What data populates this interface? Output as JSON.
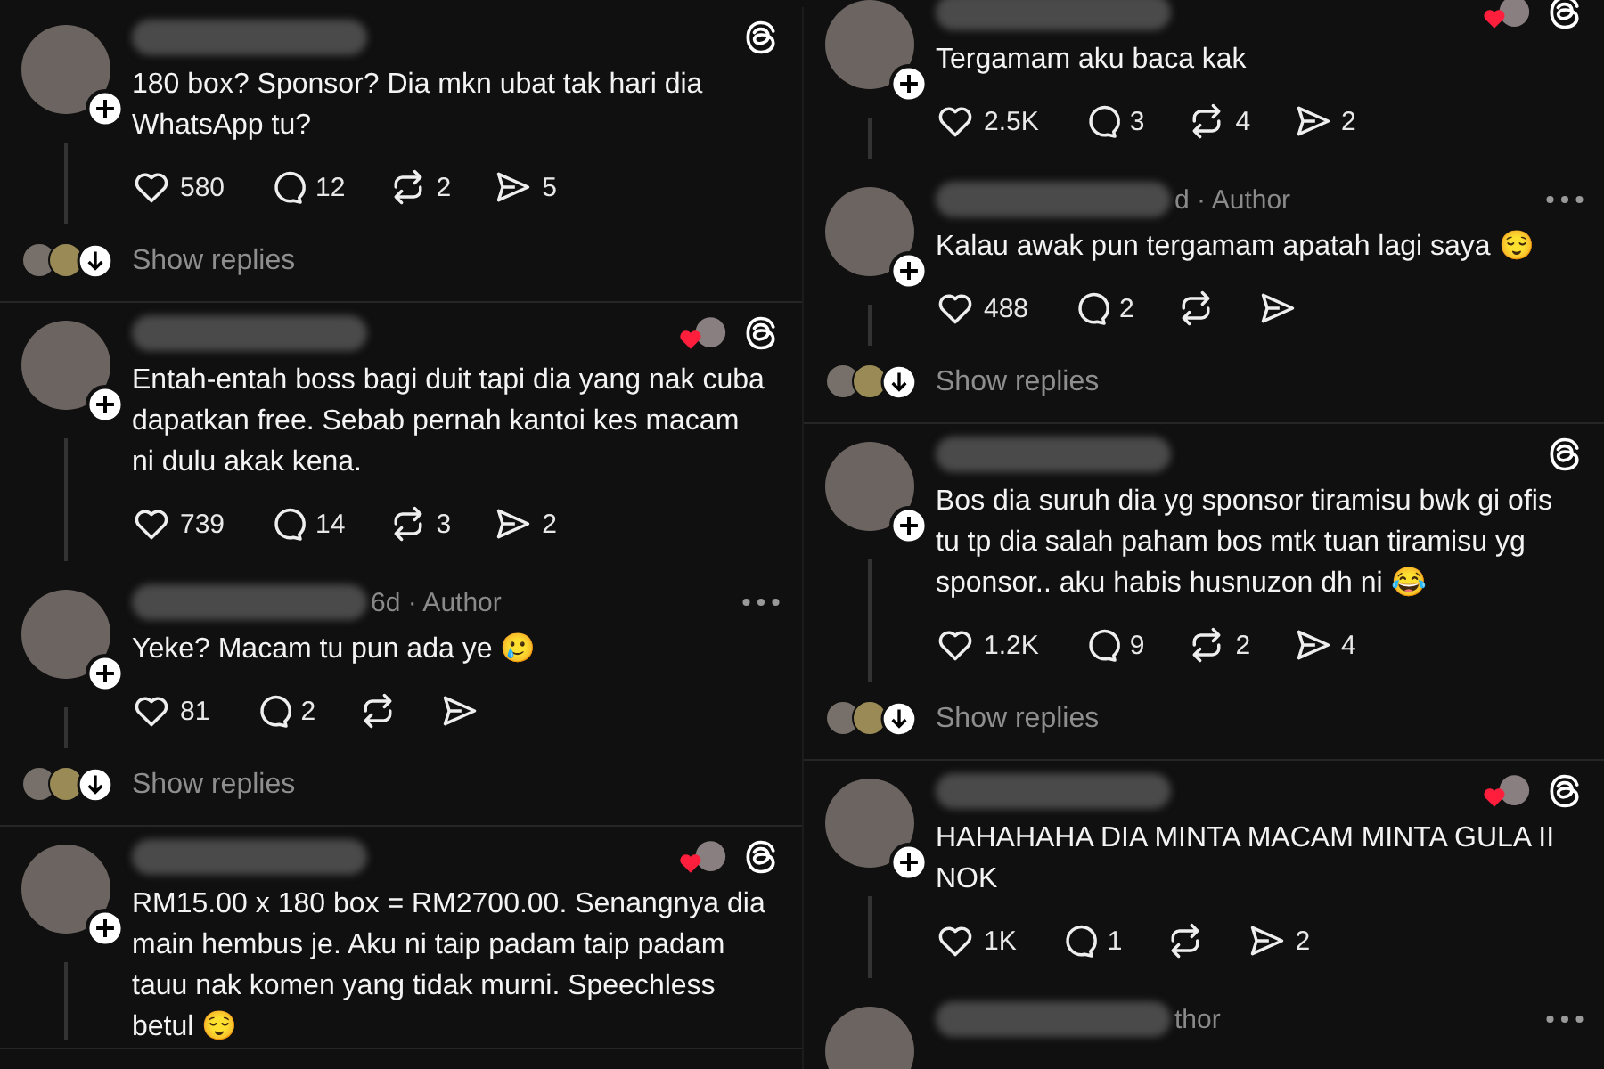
{
  "columns": [
    {
      "groups": [
        {
          "posts": [
            {
              "kind": "post",
              "text": "180 box? Sponsor? Dia mkn ubat tak hari dia WhatsApp tu?",
              "liked_by_author": false,
              "actions": [
                {
                  "kind": "like",
                  "count": "580"
                },
                {
                  "kind": "reply",
                  "count": "12"
                },
                {
                  "kind": "repost",
                  "count": "2"
                },
                {
                  "kind": "share",
                  "count": "5"
                }
              ]
            }
          ],
          "show_replies": "Show replies"
        },
        {
          "posts": [
            {
              "kind": "post",
              "text": "Entah-entah boss bagi duit tapi dia yang nak cuba dapatkan free. Sebab pernah kantoi kes macam ni dulu akak kena.",
              "liked_by_author": true,
              "actions": [
                {
                  "kind": "like",
                  "count": "739"
                },
                {
                  "kind": "reply",
                  "count": "14"
                },
                {
                  "kind": "repost",
                  "count": "3"
                },
                {
                  "kind": "share",
                  "count": "2"
                }
              ]
            },
            {
              "kind": "reply",
              "meta": "6d · Author",
              "text": "Yeke? Macam tu pun ada ye 🥲",
              "liked_by_author": false,
              "actions": [
                {
                  "kind": "like",
                  "count": "81"
                },
                {
                  "kind": "reply",
                  "count": "2"
                },
                {
                  "kind": "repost"
                },
                {
                  "kind": "share"
                }
              ]
            }
          ],
          "show_replies": "Show replies"
        },
        {
          "posts": [
            {
              "kind": "post",
              "text": "RM15.00 x 180 box = RM2700.00. Senangnya dia main hembus je. Aku ni taip padam taip padam tauu nak komen yang tidak murni. Speechless betul 😌",
              "liked_by_author": true
            }
          ]
        }
      ]
    },
    {
      "groups": [
        {
          "posts": [
            {
              "kind": "post",
              "text": "Tergamam aku baca kak",
              "liked_by_author": true,
              "actions": [
                {
                  "kind": "like",
                  "count": "2.5K"
                },
                {
                  "kind": "reply",
                  "count": "3"
                },
                {
                  "kind": "repost",
                  "count": "4"
                },
                {
                  "kind": "share",
                  "count": "2"
                }
              ]
            },
            {
              "kind": "reply",
              "meta": "d · Author",
              "text": "Kalau awak pun tergamam apatah lagi saya 😌",
              "liked_by_author": false,
              "actions": [
                {
                  "kind": "like",
                  "count": "488"
                },
                {
                  "kind": "reply",
                  "count": "2"
                },
                {
                  "kind": "repost"
                },
                {
                  "kind": "share"
                }
              ]
            }
          ],
          "show_replies": "Show replies"
        },
        {
          "posts": [
            {
              "kind": "post",
              "text": "Bos dia suruh dia yg sponsor tiramisu bwk gi ofis tu tp dia salah paham bos mtk tuan tiramisu yg sponsor.. aku habis husnuzon dh ni 😂",
              "liked_by_author": false,
              "actions": [
                {
                  "kind": "like",
                  "count": "1.2K"
                },
                {
                  "kind": "reply",
                  "count": "9"
                },
                {
                  "kind": "repost",
                  "count": "2"
                },
                {
                  "kind": "share",
                  "count": "4"
                }
              ]
            }
          ],
          "show_replies": "Show replies"
        },
        {
          "posts": [
            {
              "kind": "post",
              "text": "HAHAHAHA DIA MINTA MACAM MINTA GULA II NOK",
              "liked_by_author": true,
              "actions": [
                {
                  "kind": "like",
                  "count": "1K"
                },
                {
                  "kind": "reply",
                  "count": "1"
                },
                {
                  "kind": "repost"
                },
                {
                  "kind": "share",
                  "count": "2"
                }
              ]
            },
            {
              "kind": "reply",
              "meta": "thor",
              "liked_by_author": false
            }
          ]
        }
      ]
    }
  ]
}
